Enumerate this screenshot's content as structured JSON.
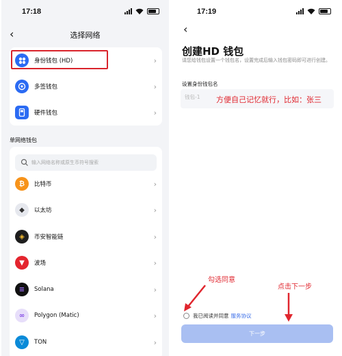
{
  "left": {
    "status_time": "17:18",
    "title": "选择网络",
    "wallet_types": [
      {
        "label": "身份钱包 (HD)",
        "icon": "grid-icon",
        "color": "#2b6bf3"
      },
      {
        "label": "多签钱包",
        "icon": "multisig-icon",
        "color": "#2b6bf3"
      },
      {
        "label": "硬件钱包",
        "icon": "hardware-icon",
        "color": "#2b6bf3"
      }
    ],
    "section_label": "单网络钱包",
    "search_placeholder": "输入网络名称或原生币符号搜索",
    "networks": [
      {
        "label": "比特币",
        "icon": "bitcoin-icon",
        "color": "#f7931a",
        "glyph": "₿"
      },
      {
        "label": "以太坊",
        "icon": "ethereum-icon",
        "color": "#e6e8ee",
        "glyph": "◆"
      },
      {
        "label": "币安智能链",
        "icon": "bnb-icon",
        "color": "#1e1e1e",
        "glyph": "◈"
      },
      {
        "label": "波场",
        "icon": "tron-icon",
        "color": "#e4252e",
        "glyph": "▼"
      },
      {
        "label": "Solana",
        "icon": "solana-icon",
        "color": "#111111",
        "glyph": "≡"
      },
      {
        "label": "Polygon (Matic)",
        "icon": "polygon-icon",
        "color": "#e7defa",
        "glyph": "∞"
      },
      {
        "label": "TON",
        "icon": "ton-icon",
        "color": "#0a8ad8",
        "glyph": "▽"
      }
    ]
  },
  "right": {
    "status_time": "17:19",
    "title": "创建HD 钱包",
    "description": "请您给钱包设置一个钱包名，设置完成后输入钱包密码即可进行创建。",
    "field_label": "设置身份钱包名",
    "input_placeholder": "钱包-1",
    "annotation_name": "方便自己记忆就行，比如：张三",
    "annotation_agree": "勾选同意",
    "annotation_next": "点击下一步",
    "agree_text": "我已阅读并同意",
    "agree_link": "服务协议",
    "next_label": "下一步"
  },
  "colors": {
    "accent": "#2b6bf3",
    "annotation_red": "#e0262e",
    "button_disabled": "#a9bff2"
  }
}
